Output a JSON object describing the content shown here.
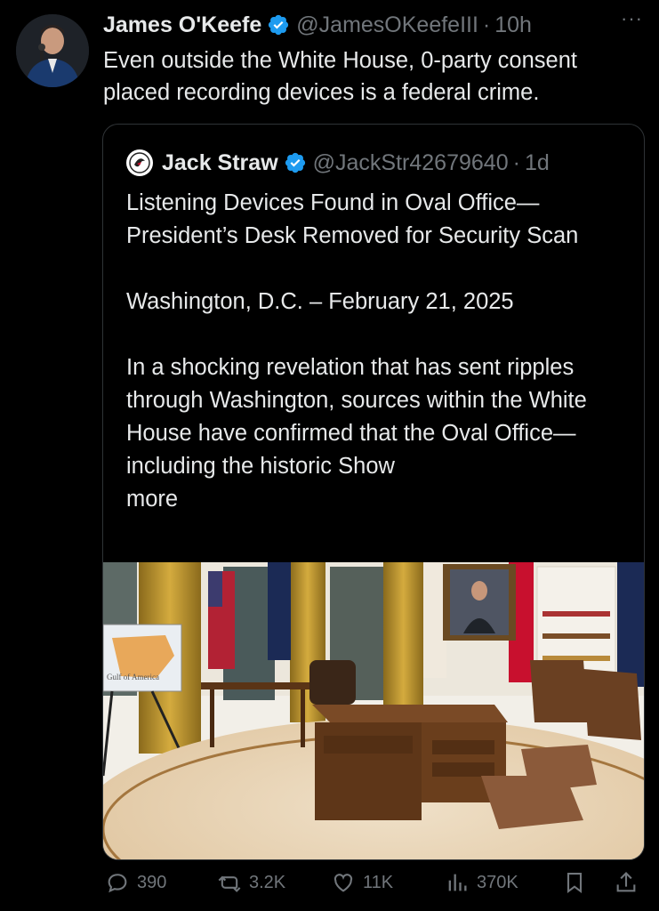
{
  "tweet": {
    "author_name": "James O'Keefe",
    "handle": "@JamesOKeefeIII",
    "time": "10h",
    "text": "Even outside the White House, 0-party consent placed recording devices is a federal crime."
  },
  "quoted": {
    "author_name": "Jack Straw",
    "handle": "@JackStr42679640",
    "time": "1d",
    "text": "Listening Devices Found in Oval Office—President’s Desk Removed for Security Scan\n\nWashington, D.C. – February 21, 2025\n\nIn a shocking revelation that has sent ripples through Washington, sources within the White House have confirmed that the Oval Office—including the historic Show\nmore",
    "image_map_label": "Gulf of America"
  },
  "actions": {
    "replies": "390",
    "retweets": "3.2K",
    "likes": "11K",
    "views": "370K"
  },
  "colors": {
    "accent": "#1d9bf0",
    "muted": "#71767b",
    "text": "#e7e9ea",
    "border": "#2f3336"
  }
}
